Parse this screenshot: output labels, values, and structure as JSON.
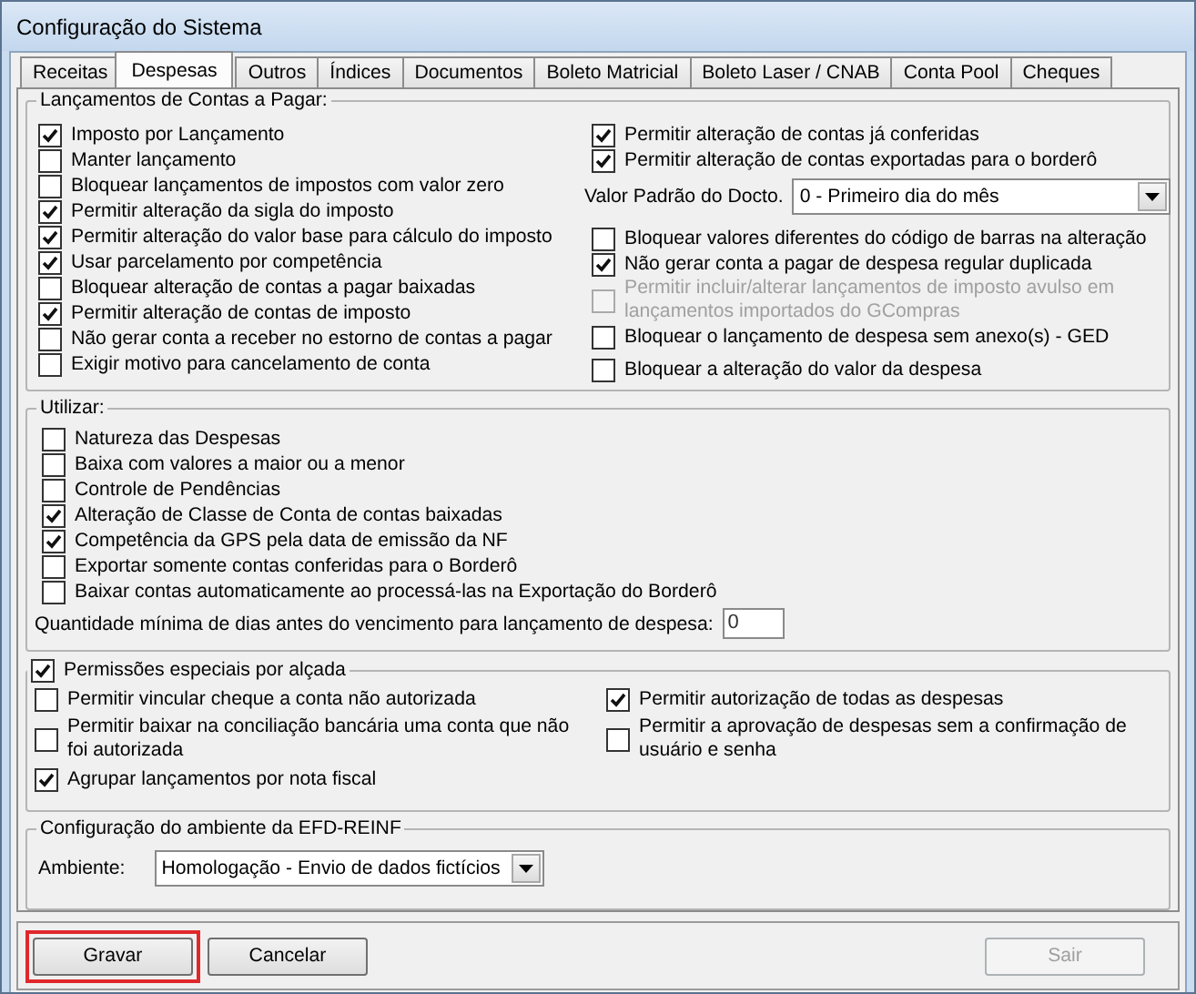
{
  "window": {
    "title": "Configuração do Sistema"
  },
  "tabs": [
    {
      "label": "Receitas",
      "selected": false
    },
    {
      "label": "Despesas",
      "selected": true
    },
    {
      "label": "Outros",
      "selected": false
    },
    {
      "label": "Índices",
      "selected": false
    },
    {
      "label": "Documentos",
      "selected": false
    },
    {
      "label": "Boleto Matricial",
      "selected": false
    },
    {
      "label": "Boleto Laser / CNAB",
      "selected": false
    },
    {
      "label": "Conta Pool",
      "selected": false
    },
    {
      "label": "Cheques",
      "selected": false
    }
  ],
  "payables": {
    "title": "Lançamentos de Contas a Pagar:",
    "left": [
      {
        "label": "Imposto por Lançamento",
        "checked": true
      },
      {
        "label": "Manter lançamento",
        "checked": false
      },
      {
        "label": "Bloquear lançamentos de impostos com valor zero",
        "checked": false
      },
      {
        "label": "Permitir alteração da sigla do imposto",
        "checked": true
      },
      {
        "label": "Permitir alteração do valor base para cálculo do imposto",
        "checked": true
      },
      {
        "label": "Usar parcelamento por competência",
        "checked": true
      },
      {
        "label": "Bloquear alteração de contas a pagar baixadas",
        "checked": false
      },
      {
        "label": "Permitir alteração de contas de imposto",
        "checked": true
      },
      {
        "label": "Não gerar conta a receber no estorno de contas a pagar",
        "checked": false
      },
      {
        "label": "Exigir motivo para cancelamento de conta",
        "checked": false
      }
    ],
    "right_top": [
      {
        "label": "Permitir alteração de contas já conferidas",
        "checked": true
      },
      {
        "label": "Permitir alteração de contas exportadas para o borderô",
        "checked": true
      }
    ],
    "default_doc": {
      "label": "Valor Padrão do Docto.",
      "value": "0 - Primeiro dia do mês"
    },
    "right_bottom": [
      {
        "label": "Bloquear valores diferentes do código de barras na alteração",
        "checked": false,
        "disabled": false
      },
      {
        "label": "Não gerar conta a pagar de despesa regular duplicada",
        "checked": true,
        "disabled": false
      },
      {
        "label": "Permitir incluir/alterar lançamentos de imposto avulso em lançamentos importados do GCompras",
        "checked": false,
        "disabled": true
      },
      {
        "label": "Bloquear o lançamento de despesa sem anexo(s) - GED",
        "checked": false,
        "disabled": false
      },
      {
        "label": "Bloquear a alteração do valor da despesa",
        "checked": false,
        "disabled": false
      }
    ]
  },
  "use": {
    "title": "Utilizar:",
    "options": [
      {
        "label": "Natureza das Despesas",
        "checked": false
      },
      {
        "label": "Baixa com valores a maior ou a menor",
        "checked": false
      },
      {
        "label": "Controle de Pendências",
        "checked": false
      },
      {
        "label": "Alteração de Classe de Conta de contas baixadas",
        "checked": true
      },
      {
        "label": "Competência da GPS pela data de emissão da NF",
        "checked": true
      },
      {
        "label": "Exportar somente contas conferidas para o Borderô",
        "checked": false
      },
      {
        "label": "Baixar contas automaticamente ao processá-las na Exportação do Borderô",
        "checked": false
      }
    ],
    "min_days": {
      "label": "Quantidade mínima de dias antes do vencimento para lançamento de despesa:",
      "value": "0"
    }
  },
  "special": {
    "title": "Permissões especiais por alçada",
    "checked": true,
    "left": [
      {
        "label": "Permitir vincular cheque a conta não autorizada",
        "checked": false
      },
      {
        "label": "Permitir baixar na conciliação bancária uma conta que não foi autorizada",
        "checked": false
      },
      {
        "label": "Agrupar lançamentos por nota fiscal",
        "checked": true
      }
    ],
    "right": [
      {
        "label": "Permitir autorização de todas as despesas",
        "checked": true
      },
      {
        "label": "Permitir a aprovação de despesas sem a confirmação de usuário e senha",
        "checked": false
      }
    ]
  },
  "efd": {
    "title": "Configuração do ambiente da EFD-REINF",
    "environment": {
      "label": "Ambiente:",
      "value": "Homologação - Envio de dados fictícios"
    }
  },
  "buttons": [
    {
      "label": "Gravar",
      "highlighted": true,
      "disabled": false
    },
    {
      "label": "Cancelar",
      "highlighted": false,
      "disabled": false
    },
    {
      "label": "Sair",
      "highlighted": false,
      "disabled": true
    }
  ]
}
